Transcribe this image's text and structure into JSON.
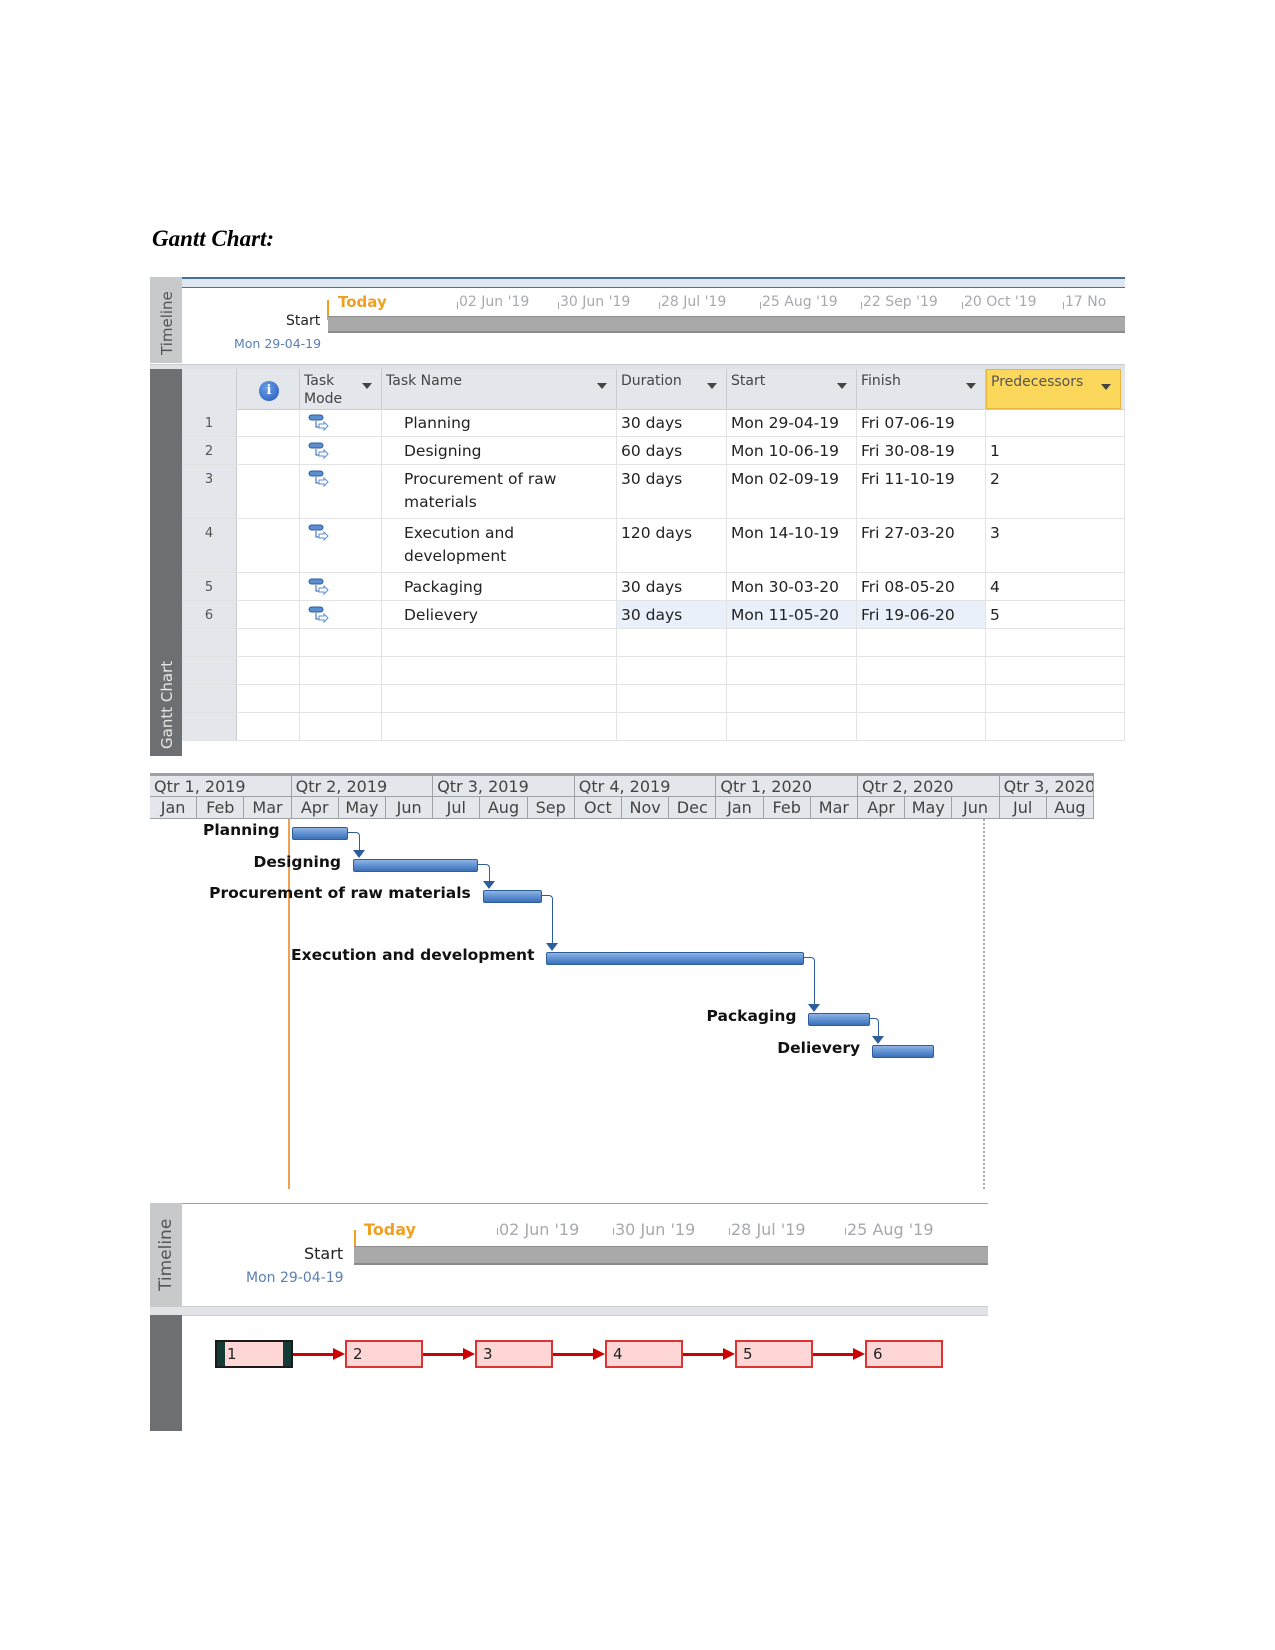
{
  "document": {
    "heading": "Gantt Chart:"
  },
  "timeline_top": {
    "rail_label": "Timeline",
    "today_label": "Today",
    "ticks": [
      "02 Jun '19",
      "30 Jun '19",
      "28 Jul '19",
      "25 Aug '19",
      "22 Sep '19",
      "20 Oct '19",
      "17 No"
    ],
    "start_label": "Start",
    "start_date": "Mon 29-04-19"
  },
  "table": {
    "rail_label": "Gantt Chart",
    "info_icon": "i",
    "columns": [
      "Task Mode",
      "Task Name",
      "Duration",
      "Start",
      "Finish",
      "Predecessors"
    ],
    "rows": [
      {
        "id": "1",
        "name": "Planning",
        "duration": "30 days",
        "start": "Mon 29-04-19",
        "finish": "Fri 07-06-19",
        "pred": ""
      },
      {
        "id": "2",
        "name": "Designing",
        "duration": "60 days",
        "start": "Mon 10-06-19",
        "finish": "Fri 30-08-19",
        "pred": "1"
      },
      {
        "id": "3",
        "name": "Procurement of raw materials",
        "duration": "30 days",
        "start": "Mon 02-09-19",
        "finish": "Fri 11-10-19",
        "pred": "2"
      },
      {
        "id": "4",
        "name": "Execution and development",
        "duration": "120 days",
        "start": "Mon 14-10-19",
        "finish": "Fri 27-03-20",
        "pred": "3"
      },
      {
        "id": "5",
        "name": "Packaging",
        "duration": "30 days",
        "start": "Mon 30-03-20",
        "finish": "Fri 08-05-20",
        "pred": "4"
      },
      {
        "id": "6",
        "name": "Delievery",
        "duration": "30 days",
        "start": "Mon 11-05-20",
        "finish": "Fri 19-06-20",
        "pred": "5"
      }
    ]
  },
  "gantt": {
    "quarters": [
      "Qtr 1, 2019",
      "Qtr 2, 2019",
      "Qtr 3, 2019",
      "Qtr 4, 2019",
      "Qtr 1, 2020",
      "Qtr 2, 2020",
      "Qtr 3, 2020"
    ],
    "months": [
      "Jan",
      "Feb",
      "Mar",
      "Apr",
      "May",
      "Jun",
      "Jul",
      "Aug",
      "Sep",
      "Oct",
      "Nov",
      "Dec",
      "Jan",
      "Feb",
      "Mar",
      "Apr",
      "May",
      "Jun",
      "Jul",
      "Aug"
    ],
    "tasks": [
      {
        "label": "Planning",
        "start_month": 4.0,
        "end_month": 5.2
      },
      {
        "label": "Designing",
        "start_month": 5.3,
        "end_month": 7.95
      },
      {
        "label": "Procurement of raw materials",
        "start_month": 8.05,
        "end_month": 9.3
      },
      {
        "label": "Execution and development",
        "start_month": 9.4,
        "end_month": 14.85
      },
      {
        "label": "Packaging",
        "start_month": 14.95,
        "end_month": 16.25
      },
      {
        "label": "Delievery",
        "start_month": 16.3,
        "end_month": 17.6
      }
    ],
    "today_month": 3.93
  },
  "timeline_bottom": {
    "rail_label": "Timeline",
    "today_label": "Today",
    "ticks": [
      "02 Jun '19",
      "30 Jun '19",
      "28 Jul '19",
      "25 Aug '19"
    ],
    "start_label": "Start",
    "start_date": "Mon 29-04-19"
  },
  "network": {
    "nodes": [
      "1",
      "2",
      "3",
      "4",
      "5",
      "6"
    ],
    "selected": "1",
    "colors": {
      "box_border": "#dd3333",
      "box_fill": "#ffd6d6",
      "arrow": "#cc0000"
    }
  }
}
